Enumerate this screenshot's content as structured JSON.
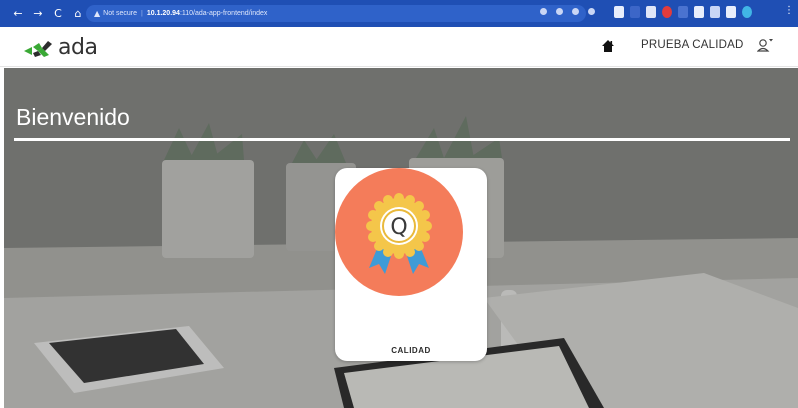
{
  "browser": {
    "nav": [
      "←",
      "→",
      "C",
      "⌂"
    ],
    "security_warning_icon": "warning-icon",
    "security_label": "Not secure",
    "host": "10.1.20.94",
    "path": ":110/ada-app-frontend/index"
  },
  "app": {
    "logo_text": "ada",
    "user_name": "PRUEBA CALIDAD",
    "home_icon": "home-icon",
    "user_icon": "user-icon"
  },
  "hero": {
    "title": "Bienvenido"
  },
  "modules": [
    {
      "label": "CALIDAD",
      "icon": "award-badge-icon",
      "badge_letter": "Q",
      "colors": {
        "circle": "#f47c5a",
        "medal": "#f4c64a",
        "ribbon": "#3f9bd6"
      }
    }
  ],
  "colors": {
    "chrome": "#1f4fb4",
    "logo_green": "#3aa935"
  }
}
